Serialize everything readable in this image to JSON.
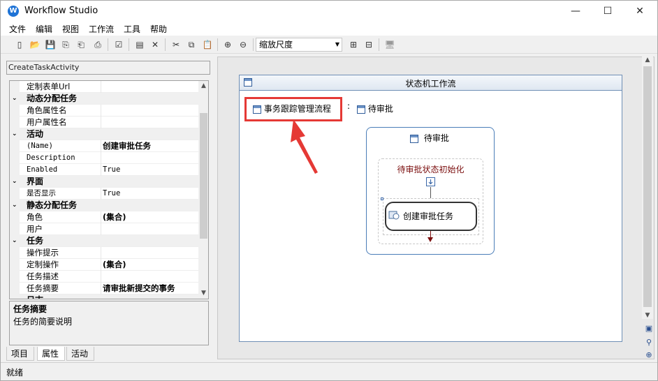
{
  "app": {
    "title": "Workflow Studio"
  },
  "window_controls": {
    "minimize": "—",
    "maximize": "☐",
    "close": "✕"
  },
  "menu": [
    "文件",
    "编辑",
    "视图",
    "工作流",
    "工具",
    "帮助"
  ],
  "toolbar": {
    "zoom_combo": "缩放尺度"
  },
  "property_panel": {
    "object_selector": "CreateTaskActivity",
    "rows": [
      {
        "type": "prop",
        "name": "定制表单Url",
        "value": ""
      },
      {
        "type": "cat",
        "name": "动态分配任务"
      },
      {
        "type": "prop",
        "name": "角色属性名",
        "value": ""
      },
      {
        "type": "prop",
        "name": "用户属性名",
        "value": ""
      },
      {
        "type": "cat",
        "name": "活动"
      },
      {
        "type": "prop",
        "name": "(Name)",
        "value": "创建审批任务",
        "mono": true,
        "bold": true
      },
      {
        "type": "prop",
        "name": "Description",
        "value": "",
        "mono": true
      },
      {
        "type": "prop",
        "name": "Enabled",
        "value": "True",
        "mono": true
      },
      {
        "type": "cat",
        "name": "界面"
      },
      {
        "type": "prop",
        "name": "是否显示",
        "value": "True",
        "mono": true
      },
      {
        "type": "cat",
        "name": "静态分配任务"
      },
      {
        "type": "prop",
        "name": "角色",
        "value": "(集合)",
        "bold": true
      },
      {
        "type": "prop",
        "name": "用户",
        "value": ""
      },
      {
        "type": "cat",
        "name": "任务"
      },
      {
        "type": "prop",
        "name": "操作提示",
        "value": ""
      },
      {
        "type": "prop",
        "name": "定制操作",
        "value": "(集合)",
        "bold": true
      },
      {
        "type": "prop",
        "name": "任务描述",
        "value": ""
      },
      {
        "type": "prop",
        "name": "任务摘要",
        "value": "请审批新提交的事务",
        "bold": true
      },
      {
        "type": "cat",
        "name": "日志"
      }
    ],
    "description": {
      "title": "任务摘要",
      "text": "任务的简要说明"
    },
    "tabs": [
      "项目",
      "属性",
      "活动"
    ],
    "active_tab": "属性"
  },
  "designer": {
    "workflow_title": "状态机工作流",
    "state_chips": [
      {
        "label": "事务跟踪管理流程",
        "highlighted": true
      },
      {
        "label": "待审批"
      }
    ],
    "state_box": {
      "title": "待审批",
      "init_title": "待审批状态初始化",
      "activity_label": "创建审批任务"
    }
  },
  "status": {
    "text": "就绪"
  },
  "colors": {
    "highlight": "#e53935",
    "state_border": "#4a7db8",
    "init_title": "#7a0d0d"
  }
}
